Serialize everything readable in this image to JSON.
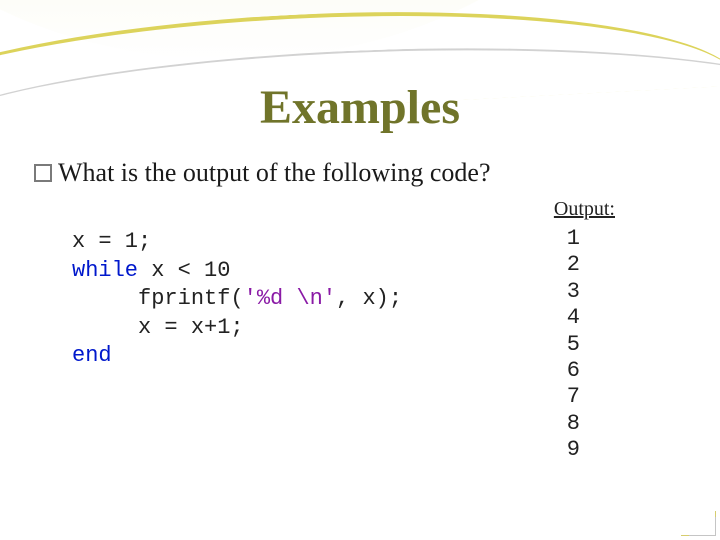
{
  "title": "Examples",
  "question": "What is the output of the following code?",
  "output_label": "Output:",
  "code": {
    "l1a": "x = 1;",
    "l2a": "while",
    "l2b": " x < 10",
    "l3a": "     fprintf(",
    "l3b": "'%d \\n'",
    "l3c": ", x);",
    "l4a": "     x = x+1;",
    "l5a": "end"
  },
  "output_values": "1\n2\n3\n4\n5\n6\n7\n8\n9"
}
